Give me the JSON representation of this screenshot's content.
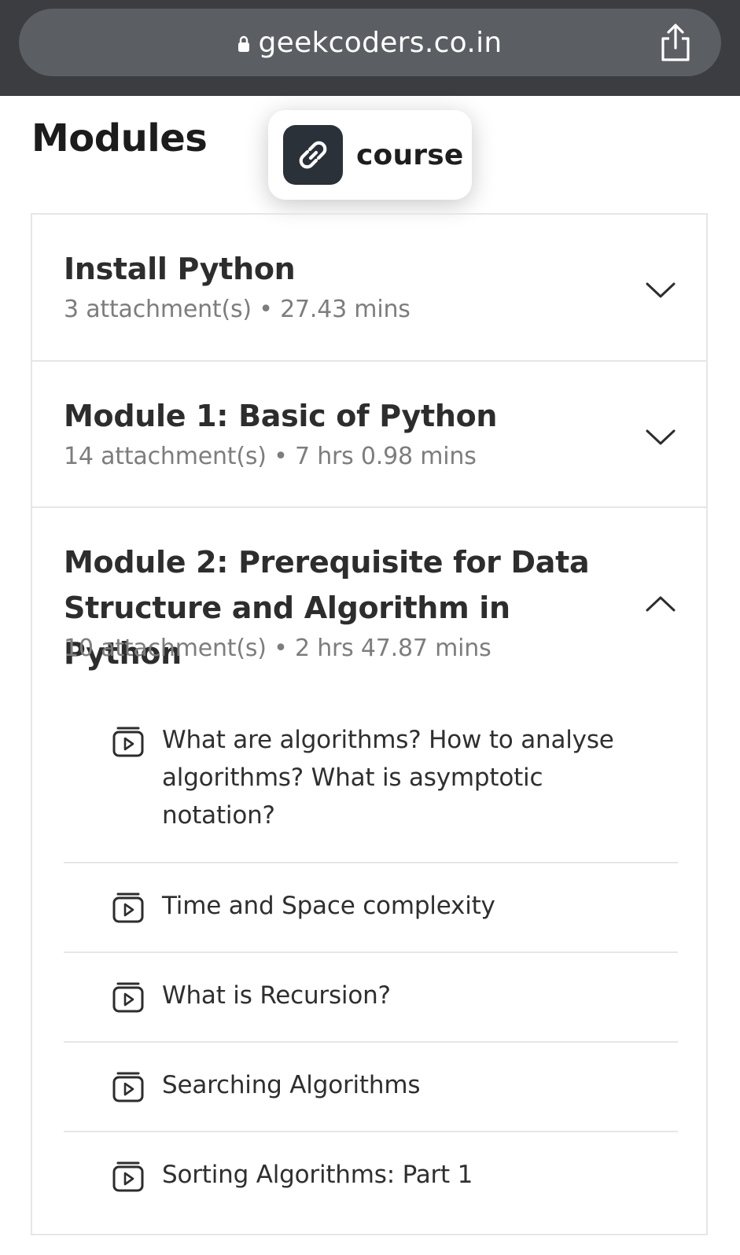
{
  "browser": {
    "url": "geekcoders.co.in",
    "icons": {
      "lock": "lock-icon",
      "share": "share-icon"
    }
  },
  "page": {
    "title": "Modules",
    "link_chip": {
      "label": "course",
      "icon": "link-icon"
    }
  },
  "modules": [
    {
      "title": "Install Python",
      "meta": "3 attachment(s) • 27.43 mins",
      "expanded": false
    },
    {
      "title": "Module 1: Basic of Python",
      "meta": "14 attachment(s) • 7 hrs 0.98 mins",
      "expanded": false
    },
    {
      "title": "Module 2: Prerequisite for Data Structure and Algorithm in Python",
      "meta": "10 attachment(s) • 2 hrs 47.87 mins",
      "expanded": true,
      "lessons": [
        "What are algorithms? How to analyse algorithms? What is asymptotic notation?",
        "Time and Space complexity",
        "What is Recursion?",
        "Searching Algorithms",
        "Sorting Algorithms: Part 1"
      ]
    }
  ],
  "colors": {
    "browser_bar": "#3b3d40",
    "url_pill": "#5b5e63",
    "chip_icon_bg": "#2b3138",
    "meta_text": "#7d7d7d",
    "border": "#e6e6e6"
  }
}
